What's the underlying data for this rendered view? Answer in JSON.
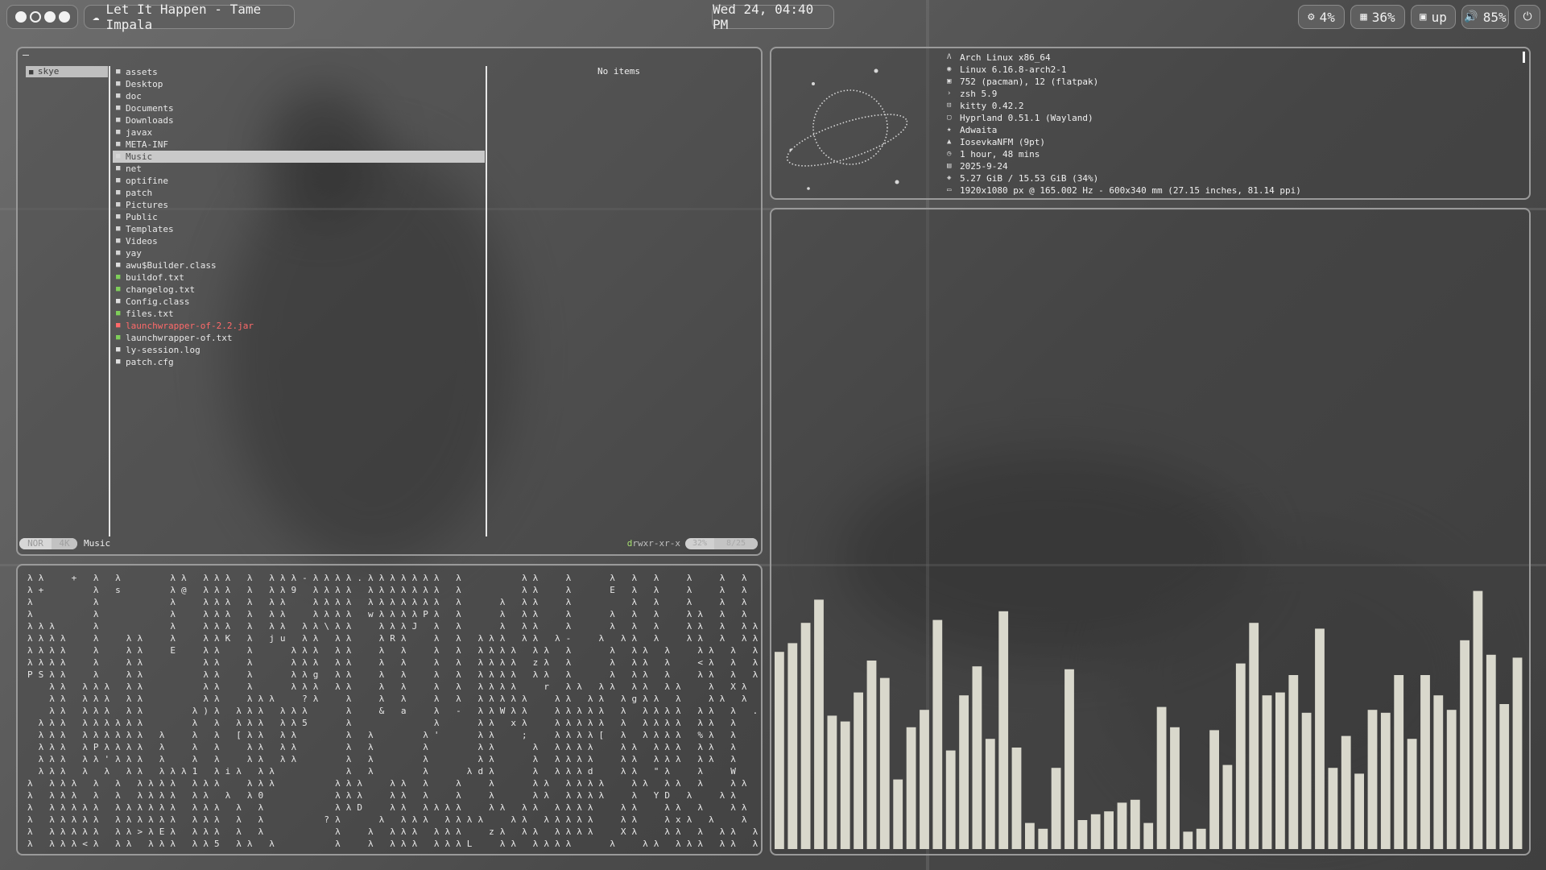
{
  "topbar": {
    "workspaces": [
      {
        "name": "ws-1",
        "state": "active"
      },
      {
        "name": "ws-2",
        "state": "empty"
      },
      {
        "name": "ws-3",
        "state": "active"
      },
      {
        "name": "ws-4",
        "state": "active"
      }
    ],
    "media": {
      "icon": "music-icon",
      "title": "Let It Happen - Tame Impala"
    },
    "clock": "Wed 24, 04:40 PM",
    "stats": [
      {
        "icon": "cpu-icon",
        "value": "4%"
      },
      {
        "icon": "memory-icon",
        "value": "36%"
      },
      {
        "icon": "updates-icon",
        "value": "up"
      },
      {
        "icon": "volume-icon",
        "value": "85%"
      },
      {
        "icon": "power-icon",
        "value": ""
      }
    ]
  },
  "file_manager": {
    "parent_entries": [
      "skye"
    ],
    "entries": [
      {
        "name": "assets",
        "kind": "folder"
      },
      {
        "name": "Desktop",
        "kind": "folder"
      },
      {
        "name": "doc",
        "kind": "folder"
      },
      {
        "name": "Documents",
        "kind": "folder"
      },
      {
        "name": "Downloads",
        "kind": "folder"
      },
      {
        "name": "javax",
        "kind": "folder"
      },
      {
        "name": "META-INF",
        "kind": "folder"
      },
      {
        "name": "Music",
        "kind": "folder",
        "selected": true
      },
      {
        "name": "net",
        "kind": "folder"
      },
      {
        "name": "optifine",
        "kind": "folder"
      },
      {
        "name": "patch",
        "kind": "folder"
      },
      {
        "name": "Pictures",
        "kind": "folder"
      },
      {
        "name": "Public",
        "kind": "folder"
      },
      {
        "name": "Templates",
        "kind": "folder"
      },
      {
        "name": "Videos",
        "kind": "folder"
      },
      {
        "name": "yay",
        "kind": "folder"
      },
      {
        "name": "awu$Builder.class",
        "kind": "plain"
      },
      {
        "name": "buildof.txt",
        "kind": "file"
      },
      {
        "name": "changelog.txt",
        "kind": "file"
      },
      {
        "name": "Config.class",
        "kind": "plain"
      },
      {
        "name": "files.txt",
        "kind": "file"
      },
      {
        "name": "launchwrapper-of-2.2.jar",
        "kind": "jar"
      },
      {
        "name": "launchwrapper-of.txt",
        "kind": "file"
      },
      {
        "name": "ly-session.log",
        "kind": "plain"
      },
      {
        "name": "patch.cfg",
        "kind": "plain"
      }
    ],
    "preview_text": "No items",
    "status": {
      "mode": "NOR",
      "size": "4K",
      "cwd": "Music",
      "permissions": {
        "d": "d",
        "r": "rwxr-xr-x"
      },
      "percent": "32%",
      "position": "8/25"
    }
  },
  "fastfetch": {
    "rows": [
      {
        "icon": "arch-icon",
        "text": "Arch Linux x86_64"
      },
      {
        "icon": "kernel-icon",
        "text": "Linux 6.16.8-arch2-1"
      },
      {
        "icon": "package-icon",
        "text": "752 (pacman), 12 (flatpak)"
      },
      {
        "icon": "shell-icon",
        "text": "zsh 5.9"
      },
      {
        "icon": "terminal-icon",
        "text": "kitty 0.42.2"
      },
      {
        "icon": "wm-icon",
        "text": "Hyprland 0.51.1 (Wayland)"
      },
      {
        "icon": "theme-icon",
        "text": "Adwaita"
      },
      {
        "icon": "font-icon",
        "text": "IosevkaNFM (9pt)"
      },
      {
        "icon": "uptime-icon",
        "text": "1 hour, 48 mins"
      },
      {
        "icon": "calendar-icon",
        "text": "2025-9-24"
      },
      {
        "icon": "memory-icon",
        "text": "5.27 GiB / 15.53 GiB (34%)"
      },
      {
        "icon": "display-icon",
        "text": "1920x1080 px @ 165.002 Hz - 600x340 mm (27.15 inches, 81.14 ppi)"
      }
    ]
  },
  "matrix_text": [
    "λ λ     +   λ   λ         λ λ   λ λ λ   λ   λ λ λ - λ λ λ λ . λ λ λ λ λ λ λ   λ           λ λ     λ       λ   λ   λ     λ     λ   λ   λ λ   λ λ λ",
    "λ +         λ   s         λ @   λ λ λ   λ   λ λ 9   λ λ λ λ   λ λ λ λ λ λ λ   λ           λ λ     λ       E   λ   λ     λ     λ   λ   λ λ   λ λ λ",
    "λ           λ             λ     λ λ λ   λ   λ λ     λ λ λ λ   λ λ λ λ λ λ λ   λ       λ   λ λ     λ           λ   λ     λ     λ   λ   λ λ λ 1 λ λ λ λ",
    "λ           λ             λ     λ λ λ   λ   λ λ     λ λ λ λ   w λ λ λ λ P λ   λ       λ   λ λ     λ       λ   λ   λ     λ λ   λ   λ   λ λ   λ λ λ λ",
    "λ λ λ       λ             λ     λ λ λ   λ   λ λ   λ λ \\ λ λ     λ λ λ J   λ   λ       λ   λ λ     λ       λ   λ   λ     λ λ   λ   λ λ 2 λ z   λ λ λ u λ",
    "λ λ λ λ     λ     λ λ     λ     λ λ K   λ   j u   λ λ   λ λ     λ R λ     λ   λ   λ λ λ   λ λ   λ -     λ   λ λ   λ     λ λ   λ   λ λ   λ     λ λ λ   λ",
    "λ λ λ λ     λ     λ λ     E     λ λ     λ       λ λ λ   λ λ     λ   λ     λ   λ   λ λ λ λ   λ λ   λ       λ   λ λ   λ     λ λ   λ   λ λ   λ     λ λ λ   λ",
    "λ λ λ λ     λ     λ λ           λ λ     λ       λ λ λ   λ λ     λ   λ     λ   λ   λ λ λ λ   z λ   λ       λ   λ λ   λ     < λ   λ   λ λ   λ     λ λ λ   λ",
    "P S λ λ     λ     λ λ           λ λ     λ       λ λ g   λ λ     λ   λ     λ   λ   λ λ λ λ   λ λ   λ       λ   λ λ   λ     λ λ   λ   λ λ   λ     λ λ λ   λ",
    "    λ λ   λ λ λ   λ λ           λ λ     λ       λ λ λ   λ λ     λ   λ     λ   λ   λ λ λ λ     r   λ λ   λ λ   λ λ   λ λ     λ   X λ   λ     λ λ λ   λ λ",
    "    λ λ   λ λ λ   λ λ           λ λ     λ λ λ     ? λ     λ     λ   λ     λ   λ   λ λ λ λ λ     λ λ   λ λ   λ g λ λ   λ     λ λ   λ   λ λ   λ λ λ 4   λ !",
    "    λ λ   λ λ λ   λ λ         λ ) λ   λ λ λ   λ λ λ       λ     &   a     λ   -   λ λ W λ λ     λ λ λ λ λ   λ   λ λ λ λ   λ λ   λ   .     λ λ λ     λ",
    "  λ λ λ   λ λ λ λ λ λ         λ   λ   λ λ λ   λ λ 5       λ               λ       λ λ   x λ     λ λ λ λ λ   λ   λ λ λ λ   λ λ   λ         λ λ λ     λ",
    "  λ λ λ   λ λ λ λ λ λ   λ     λ   λ   [ λ λ   λ λ         λ   λ         λ '       λ λ     ;     λ λ λ λ [   λ   λ λ λ λ   % λ   λ         λ λ λ     λ",
    "  λ λ λ   λ P λ λ λ λ   λ     λ   λ     λ λ   λ λ         λ   λ         λ         λ λ       λ   λ λ λ λ     λ λ   λ λ λ   λ λ   λ       λ λ λ λ     λ",
    "  λ λ λ   λ λ ' λ λ λ   λ     λ   λ     λ λ   λ λ         λ   λ         λ         λ λ       λ   λ λ λ λ     λ λ   λ λ λ   λ λ   λ       λ λ λ ;     λ",
    "  λ λ λ   λ   λ   λ λ   λ λ λ 1   λ i λ   λ λ             λ   λ         λ       λ d λ       λ   λ λ λ d     λ λ   \" λ     λ     W       λ λ   o     λ",
    "λ   λ λ λ   λ   λ   λ λ λ λ   λ λ λ     λ λ λ           λ λ λ     λ λ   λ     λ     λ       λ λ   λ λ λ λ     λ λ   λ λ   λ     λ λ         λ       λ",
    "λ   λ λ λ   λ   λ   λ λ λ λ   λ λ   λ   λ 0             λ λ λ     λ λ   λ     λ     λ       λ λ   λ λ λ λ     λ   Y D   λ     λ λ         λ λ       λ",
    "λ   λ λ λ λ λ   λ λ λ λ λ λ   λ λ λ   λ   λ             λ λ D     λ λ   λ λ λ λ     λ λ   λ λ   λ λ λ λ     λ λ     λ λ   λ     λ λ         λ _       λ",
    "λ   λ λ λ λ λ   λ λ λ λ λ λ   λ λ λ   λ   λ           ? λ       λ   λ λ λ   λ λ λ λ     λ λ   λ λ λ λ λ     λ λ     λ x λ   λ     λ   λ       λ         λ",
    "λ   λ λ λ λ λ   λ λ > λ E λ   λ λ λ   λ   λ             λ     λ   λ λ λ   λ λ λ     z λ   λ λ   λ λ λ λ     X λ     λ λ   λ   λ λ   λ   λ       λ       λ",
    "λ   λ λ λ < λ   λ λ   λ λ λ   λ λ 5   λ λ   λ           λ     λ   λ λ λ   λ λ λ L     λ λ   λ λ λ λ       λ     λ λ   λ λ λ   λ λ   λ   λ       λ       λ"
  ],
  "visualizer": {
    "color": "#d9d8cc",
    "levels": [
      0.68,
      0.71,
      0.78,
      0.86,
      0.46,
      0.44,
      0.54,
      0.65,
      0.59,
      0.24,
      0.42,
      0.48,
      0.79,
      0.34,
      0.53,
      0.63,
      0.38,
      0.82,
      0.35,
      0.09,
      0.07,
      0.28,
      0.62,
      0.1,
      0.12,
      0.13,
      0.16,
      0.17,
      0.09,
      0.49,
      0.42,
      0.06,
      0.07,
      0.41,
      0.29,
      0.64,
      0.78,
      0.53,
      0.54,
      0.6,
      0.47,
      0.76,
      0.28,
      0.39,
      0.26,
      0.48,
      0.47,
      0.6,
      0.38,
      0.6,
      0.53,
      0.48,
      0.72,
      0.89,
      0.67,
      0.5,
      0.66
    ]
  }
}
